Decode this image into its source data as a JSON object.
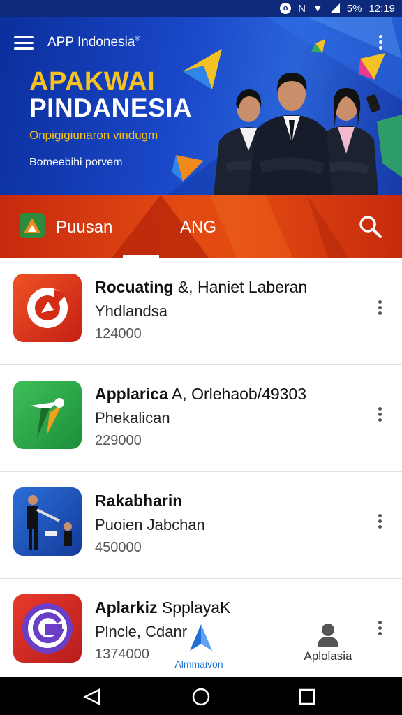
{
  "status_bar": {
    "time": "12:19",
    "battery": "5%"
  },
  "header": {
    "app_title": "APP Indonesia",
    "registered_mark": "®"
  },
  "banner": {
    "headline_1": "APAKWAI",
    "headline_2": "PINDANESIA",
    "tagline": "Onpigigiunaron vindugm",
    "subtag": "Bomeebihi porvem"
  },
  "tabs": [
    {
      "label": "Puusan",
      "selected": true
    },
    {
      "label": "ANG",
      "selected": false
    }
  ],
  "apps": [
    {
      "title_bold": "Rocuating",
      "title_rest": " &, Haniet Laberan",
      "subtitle": "Yhdlandsa",
      "count": "124000",
      "icon": "red-refresh-icon",
      "color": "#e3321a"
    },
    {
      "title_bold": "Applarica",
      "title_rest": " A, Orlehaob/49303",
      "subtitle": "Phekalican",
      "count": "229000",
      "icon": "green-arrow-icon",
      "color": "#2fa548"
    },
    {
      "title_bold": "Rakabharin",
      "title_rest": "",
      "subtitle": "Puoien Jabchan",
      "count": "450000",
      "icon": "businessman-icon",
      "color": "#1f57c4"
    },
    {
      "title_bold": "Aplarkiz",
      "title_rest": " SpplayaK",
      "subtitle": "Plncle, Cdanr",
      "count": "1374000",
      "icon": "g-circle-icon",
      "color": "#d42828"
    }
  ],
  "bottom_tabs": [
    {
      "label": "Almmaivon",
      "icon": "paper-plane-icon"
    },
    {
      "label": "Aplolasia",
      "icon": "person-icon"
    }
  ],
  "accent": {
    "brand_blue": "#0d2a7a",
    "brand_orange": "#e14a12",
    "highlight_yellow": "#f6c21f"
  }
}
